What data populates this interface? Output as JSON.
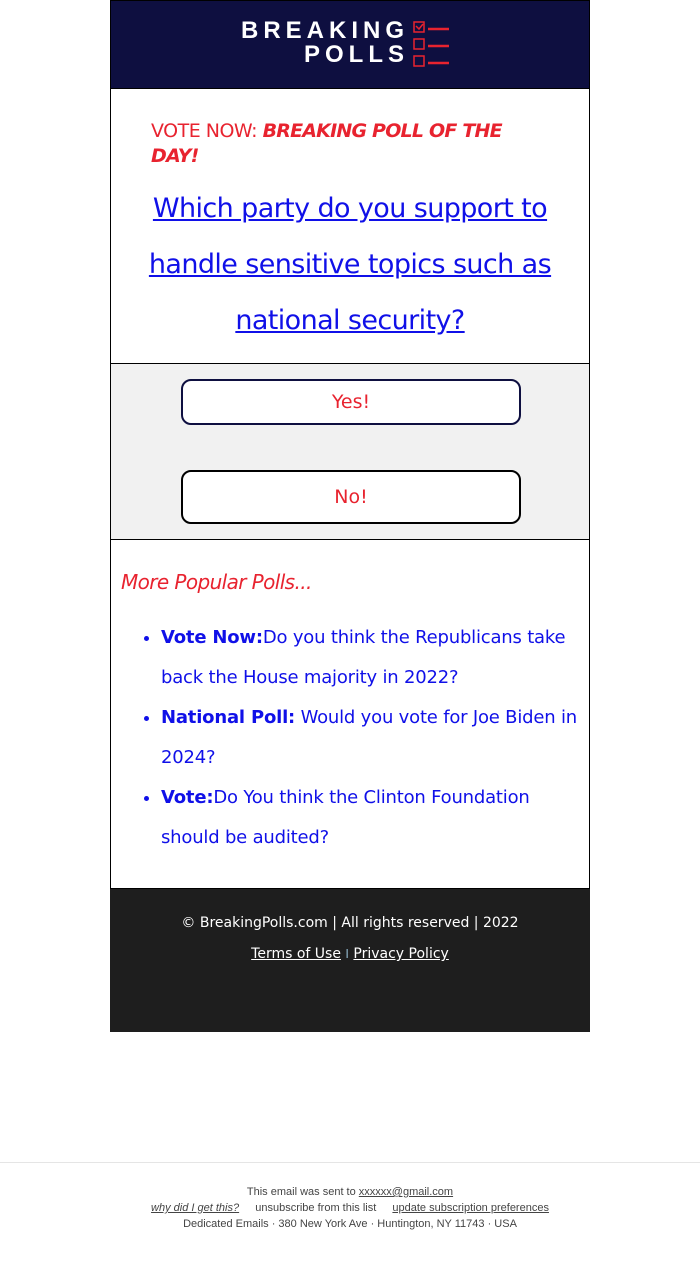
{
  "header": {
    "logo_line1": "BREAKING",
    "logo_line2": "POLLS",
    "logo_icon": "checklist-icon",
    "bg_color": "#0e0f40",
    "accent_color": "#e8232f"
  },
  "headline": {
    "lead": "VOTE NOW: ",
    "emphasis": "BREAKING POLL OF THE DAY!"
  },
  "question": {
    "text": "Which party do you support to handle sensitive topics such as national security?"
  },
  "vote_buttons": {
    "yes_label": "Yes!",
    "no_label": "No!"
  },
  "more_polls": {
    "title": "More Popular Polls...",
    "items": [
      {
        "prefix": "Vote Now:",
        "text": "Do you think the Republicans take back the House majority in 2022?"
      },
      {
        "prefix": "National Poll:",
        "text": " Would you vote for Joe Biden in 2024?"
      },
      {
        "prefix": "Vote:",
        "text": "Do You think the Clinton Foundation should be audited?"
      }
    ]
  },
  "footer": {
    "copyright": "© BreakingPolls.com | All rights reserved | 2022",
    "terms_label": "Terms of Use",
    "separator": "I",
    "privacy_label": "Privacy Policy"
  },
  "email_footer": {
    "sent_to_prefix": "This email was sent to ",
    "email": "xxxxxx@gmail.com",
    "why_label": "why did I get this?",
    "unsubscribe_label": "unsubscribe from this list",
    "update_label": "update subscription preferences",
    "address": "Dedicated Emails · 380 New York Ave · Huntington, NY 11743 · USA"
  }
}
